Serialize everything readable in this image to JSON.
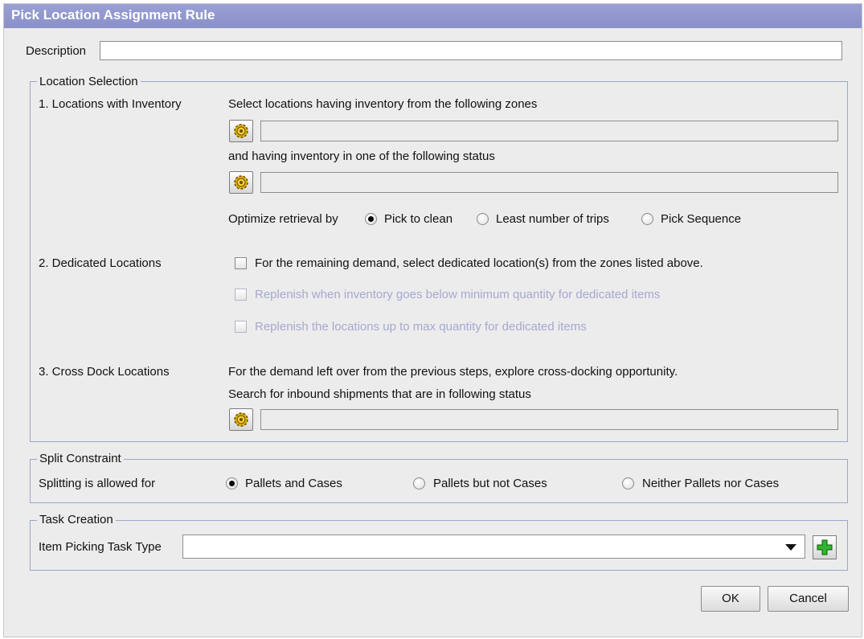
{
  "window": {
    "title": "Pick Location Assignment Rule"
  },
  "description": {
    "label": "Description",
    "value": ""
  },
  "location_selection": {
    "legend": "Location Selection",
    "inventory": {
      "heading": "1. Locations with Inventory",
      "zones_text": "Select locations having inventory from the following zones",
      "zones_value": "",
      "status_text": "and having inventory in one of the following status",
      "status_value": "",
      "optimize_label": "Optimize retrieval by",
      "options": [
        "Pick to clean",
        "Least number of trips",
        "Pick Sequence"
      ],
      "selected": "Pick to clean"
    },
    "dedicated": {
      "heading": "2. Dedicated Locations",
      "checkboxes": [
        {
          "label": "For the remaining demand, select dedicated location(s) from the zones listed above.",
          "checked": false,
          "enabled": true
        },
        {
          "label": "Replenish when inventory goes below minimum quantity for dedicated items",
          "checked": false,
          "enabled": false
        },
        {
          "label": "Replenish the locations up to max quantity for dedicated items",
          "checked": false,
          "enabled": false
        }
      ]
    },
    "cross_dock": {
      "heading": "3. Cross Dock Locations",
      "text1": "For the demand left over from the previous steps, explore cross-docking opportunity.",
      "text2": "Search for inbound shipments that are in following status",
      "status_value": ""
    }
  },
  "split_constraint": {
    "legend": "Split Constraint",
    "label": "Splitting is allowed for",
    "options": [
      "Pallets and Cases",
      "Pallets but not Cases",
      "Neither Pallets nor Cases"
    ],
    "selected": "Pallets and Cases"
  },
  "task_creation": {
    "legend": "Task Creation",
    "label": "Item Picking Task Type",
    "value": ""
  },
  "buttons": {
    "ok": "OK",
    "cancel": "Cancel"
  },
  "icons": {
    "lookup": "gear-lookup-icon",
    "add": "green-plus-icon",
    "dropdown": "triangle-down-icon"
  },
  "colors": {
    "titlebar": "#8a90c8",
    "group_border": "#9ea5c8",
    "disabled_text": "#a6a8cf",
    "background": "#ececec"
  }
}
